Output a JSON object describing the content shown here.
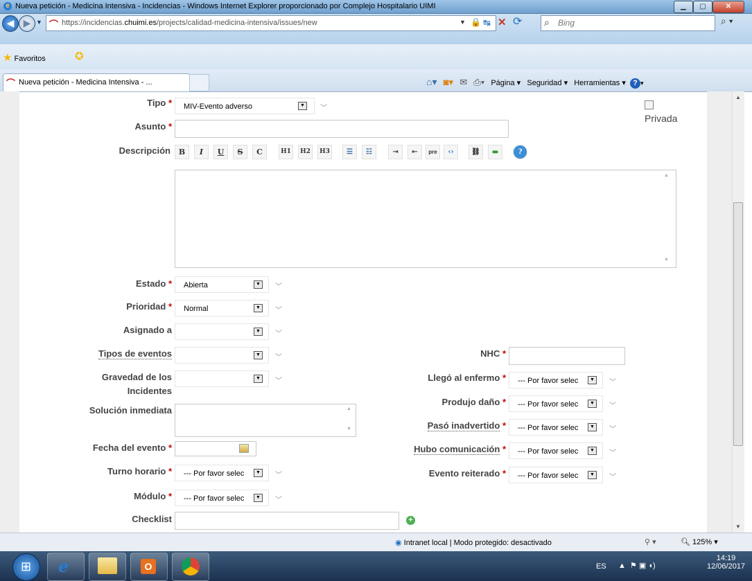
{
  "window": {
    "title": "Nueva petición - Medicina Intensiva - Incidencias - Windows Internet Explorer proporcionado por Complejo Hospitalario UIMI"
  },
  "address_bar": {
    "url_prefix": "https://incidencias.",
    "url_domain": "chuimi.es",
    "url_path": "/projects/calidad-medicina-intensiva/issues/new",
    "search_placeholder": "Bing"
  },
  "favorites": {
    "label": "Favoritos"
  },
  "tab": {
    "label": "Nueva petición - Medicina Intensiva - ..."
  },
  "command_bar": {
    "page": "Página ▾",
    "security": "Seguridad ▾",
    "tools": "Herramientas ▾"
  },
  "form": {
    "tipo": {
      "label": "Tipo",
      "value": "MIV-Evento adverso"
    },
    "privada": {
      "label": "Privada"
    },
    "asunto": {
      "label": "Asunto",
      "value": ""
    },
    "descripcion": {
      "label": "Descripción"
    },
    "toolbar": [
      "B",
      "I",
      "U",
      "S",
      "C",
      "H1",
      "H2",
      "H3",
      "ul",
      "ol",
      "l",
      "r",
      "pre",
      "<>",
      "img",
      "lnk",
      "?"
    ],
    "estado": {
      "label": "Estado",
      "value": "Abierta"
    },
    "prioridad": {
      "label": "Prioridad",
      "value": "Normal"
    },
    "asignado": {
      "label": "Asignado a",
      "value": ""
    },
    "tipos_eventos": {
      "label": "Tipos de eventos",
      "value": ""
    },
    "gravedad": {
      "label_1": "Gravedad de los",
      "label_2": "Incidentes",
      "value": ""
    },
    "solucion": {
      "label": "Solución inmediata",
      "value": ""
    },
    "fecha": {
      "label": "Fecha del evento",
      "value": ""
    },
    "turno": {
      "label": "Turno horario",
      "value": "--- Por favor selec"
    },
    "modulo": {
      "label": "Módulo",
      "value": "--- Por favor selec"
    },
    "checklist": {
      "label": "Checklist",
      "value": ""
    },
    "nhc": {
      "label": "NHC",
      "value": ""
    },
    "llego": {
      "label": "Llegó al enfermo",
      "value": "--- Por favor selec"
    },
    "produjo": {
      "label": "Produjo daño",
      "value": "--- Por favor selec"
    },
    "paso": {
      "label": "Pasó inadvertido",
      "value": "--- Por favor selec"
    },
    "hubo": {
      "label": "Hubo comunicación",
      "value": "--- Por favor selec"
    },
    "evento": {
      "label": "Evento reiterado",
      "value": "--- Por favor selec"
    },
    "required_mark": "*"
  },
  "status_bar": {
    "zone": "Intranet local | Modo protegido: desactivado",
    "zoom": "125%"
  },
  "taskbar": {
    "lang": "ES",
    "time": "14:19",
    "date": "12/06/2017"
  }
}
